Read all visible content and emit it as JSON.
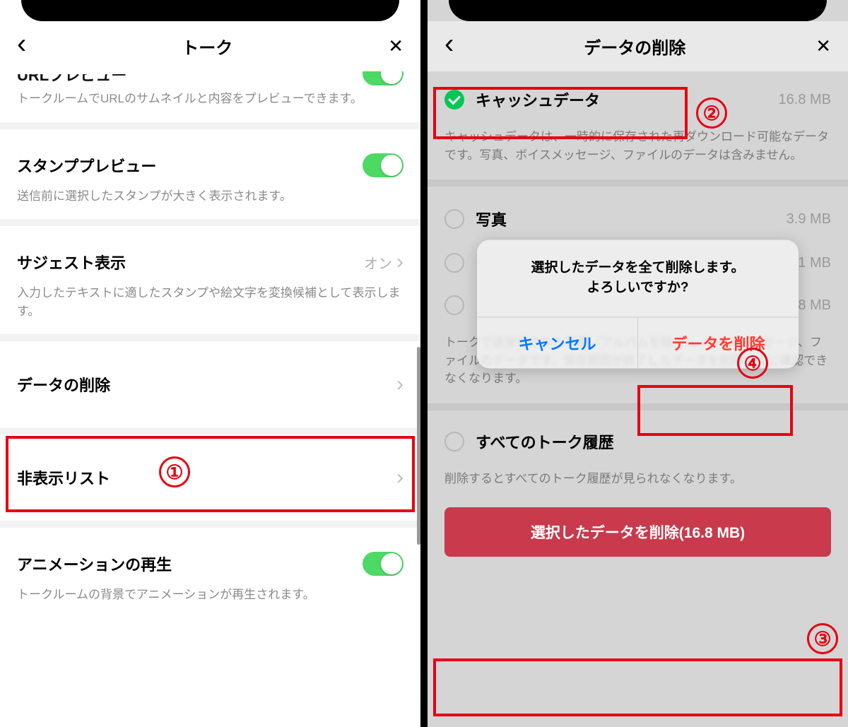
{
  "left": {
    "title": "トーク",
    "urlPreview": {
      "label": "URLプレビュー",
      "desc": "トークルームでURLのサムネイルと内容をプレビューできます。"
    },
    "stampPreview": {
      "label": "スタンププレビュー",
      "desc": "送信前に選択したスタンプが大きく表示されます。"
    },
    "suggest": {
      "label": "サジェスト表示",
      "status": "オン",
      "desc": "入力したテキストに適したスタンプや絵文字を変換候補として表示します。"
    },
    "deleteData": {
      "label": "データの削除"
    },
    "hiddenList": {
      "label": "非表示リスト"
    },
    "animation": {
      "label": "アニメーションの再生",
      "desc": "トークルームの背景でアニメーションが再生されます。"
    }
  },
  "right": {
    "title": "データの削除",
    "cache": {
      "label": "キャッシュデータ",
      "size": "16.8 MB",
      "desc": "キャッシュデータは、一時的に保存された再ダウンロード可能なデータです。写真、ボイスメッセージ、ファイルのデータは含みません。"
    },
    "photo": {
      "label": "写真",
      "size": "3.9 MB"
    },
    "row3size": "1 MB",
    "row4size": "8 MB",
    "historyDesc": "トークで送受信された写真（アルバムを除く）、ボイスメッセージ、ファイルのデータです。保存期間が終了したデータを削除すると確認できなくなります。",
    "allHistory": {
      "label": "すべてのトーク履歴"
    },
    "allHistoryDesc": "削除するとすべてのトーク履歴が見られなくなります。",
    "dialog": {
      "msg1": "選択したデータを全て削除します。",
      "msg2": "よろしいですか?",
      "cancel": "キャンセル",
      "confirm": "データを削除"
    },
    "deleteBtn": "選択したデータを削除(16.8 MB)"
  },
  "steps": {
    "s1": "①",
    "s2": "②",
    "s3": "③",
    "s4": "④"
  }
}
